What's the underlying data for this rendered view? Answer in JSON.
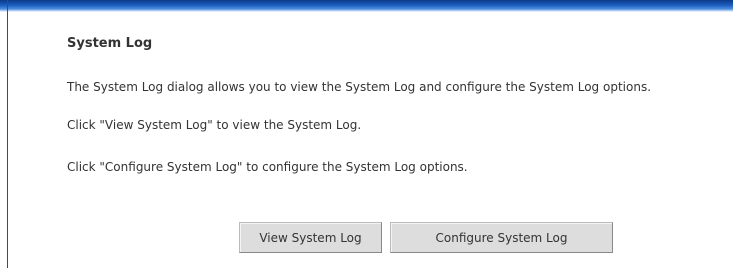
{
  "section": {
    "title": "System Log",
    "paragraphs": [
      "The System Log dialog allows you to view the System Log and configure the System Log options.",
      "Click \"View System Log\" to view the System Log.",
      "Click \"Configure System Log\" to configure the System Log options."
    ]
  },
  "buttons": {
    "view_label": "View System Log",
    "configure_label": "Configure System Log"
  },
  "colors": {
    "header_bar": "#1d5fc0",
    "left_rule": "#c8102e",
    "button_bg": "#dddddd"
  }
}
